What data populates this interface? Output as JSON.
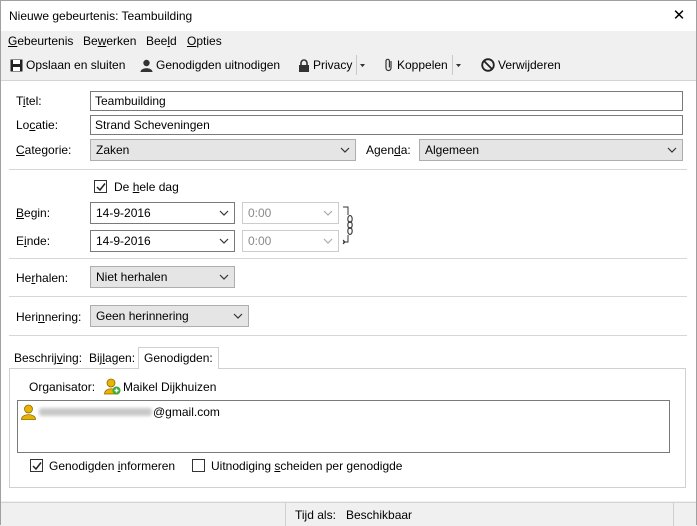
{
  "window": {
    "title": "Nieuwe gebeurtenis: Teambuilding",
    "close_glyph": "✕"
  },
  "menubar": {
    "items": [
      {
        "pre": "",
        "key": "G",
        "post": "ebeurtenis"
      },
      {
        "pre": "Be",
        "key": "w",
        "post": "erken"
      },
      {
        "pre": "Bee",
        "key": "l",
        "post": "d"
      },
      {
        "pre": "",
        "key": "O",
        "post": "pties"
      }
    ]
  },
  "toolbar": {
    "save_close": "Opslaan en sluiten",
    "invite": "Genodigden uitnodigen",
    "privacy": "Privacy",
    "attach": "Koppelen",
    "delete": "Verwijderen"
  },
  "form": {
    "title_label": {
      "pre": "T",
      "key": "i",
      "post": "tel:"
    },
    "title_value": "Teambuilding",
    "location_label": {
      "pre": "Lo",
      "key": "c",
      "post": "atie:"
    },
    "location_value": "Strand Scheveningen",
    "category_label": {
      "pre": "",
      "key": "C",
      "post": "ategorie:"
    },
    "category_value": "Zaken",
    "calendar_label": {
      "pre": "Agen",
      "key": "d",
      "post": "a:"
    },
    "calendar_value": "Algemeen",
    "allday_label": {
      "pre": "De ",
      "key": "h",
      "post": "ele dag"
    },
    "allday_checked": true,
    "begin_label": {
      "pre": "",
      "key": "B",
      "post": "egin:"
    },
    "begin_date": "14-9-2016",
    "begin_time": "0:00",
    "end_label": {
      "pre": "E",
      "key": "i",
      "post": "nde:"
    },
    "end_date": "14-9-2016",
    "end_time": "0:00",
    "repeat_label": {
      "pre": "He",
      "key": "r",
      "post": "halen:"
    },
    "repeat_value": "Niet herhalen",
    "reminder_label": {
      "pre": "Heri",
      "key": "n",
      "post": "nering:"
    },
    "reminder_value": "Geen herinnering"
  },
  "tabs": [
    {
      "pre": "Beschrij",
      "key": "v",
      "post": "ing:"
    },
    {
      "pre": "Bij",
      "key": "l",
      "post": "agen:"
    },
    {
      "pre": "Genodigden:",
      "key": "",
      "post": ""
    }
  ],
  "attendees": {
    "organizer_label": "Organisator:",
    "organizer_name": "Maikel Dijkhuizen",
    "attendee_email_suffix": "@gmail.com",
    "notify_label": {
      "pre": "Genodigden ",
      "key": "i",
      "post": "nformeren"
    },
    "notify_checked": true,
    "separate_label": {
      "pre": "Uitnodiging ",
      "key": "s",
      "post": "cheiden per genodigde"
    },
    "separate_checked": false
  },
  "status": {
    "time_as_label": "Tijd als:",
    "time_as_value": "Beschikbaar"
  },
  "colors": {
    "accent_blue": "#3b6fb6",
    "user_yellow": "#e8b400",
    "user_green": "#3aa83a"
  }
}
